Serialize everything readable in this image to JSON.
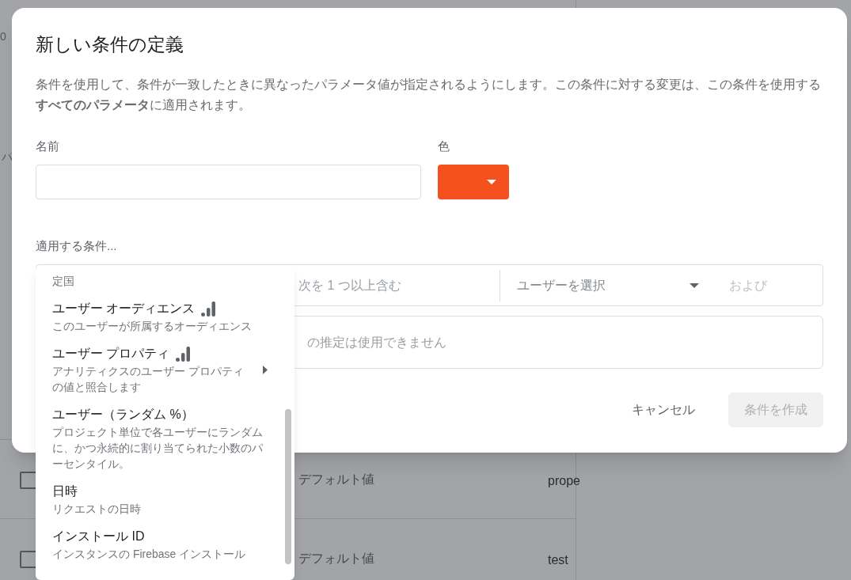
{
  "background": {
    "fragments": [
      "0",
      "パ"
    ],
    "rows": [
      {
        "checked": false,
        "label": "デフォルト値",
        "value": "prope"
      },
      {
        "checked": false,
        "label": "デフォルト値",
        "value": "test"
      }
    ]
  },
  "dialog": {
    "title": "新しい条件の定義",
    "description": "条件を使用して、条件が一致したときに異なったパラメータ値が指定されるようにします。この条件に対する変更は、この条件を使用する**すべてのパラメータ**に適用されます。",
    "name_label": "名前",
    "color_label": "色",
    "color": "#f4511e",
    "conditions_label": "適用する条件...",
    "condition": {
      "operator": "次を 1 つ以上含む",
      "select_placeholder": "ユーザーを選択",
      "and": "および",
      "message": "の推定は使用できません"
    },
    "buttons": [
      {
        "label": "キャンセル",
        "disabled": false
      },
      {
        "label": "条件を作成",
        "disabled": true
      }
    ]
  },
  "menu": {
    "items": [
      {
        "description": "定国",
        "badge": false,
        "submenu": false
      },
      {
        "title": "ユーザー オーディエンス",
        "description": "このユーザーが所属するオーディエンス",
        "badge": true,
        "submenu": false
      },
      {
        "title": "ユーザー プロパティ",
        "description": "アナリティクスのユーザー プロパティの値と照合します",
        "badge": true,
        "submenu": true
      },
      {
        "title": "ユーザー（ランダム %）",
        "description": "プロジェクト単位で各ユーザーにランダムに、かつ永続的に割り当てられた小数のパーセンタイル。",
        "badge": false,
        "submenu": false
      },
      {
        "title": "日時",
        "description": "リクエストの日時",
        "badge": false,
        "submenu": false
      },
      {
        "title": "インストール ID",
        "description": "インスタンスの Firebase インストール",
        "badge": false,
        "submenu": false
      }
    ]
  }
}
